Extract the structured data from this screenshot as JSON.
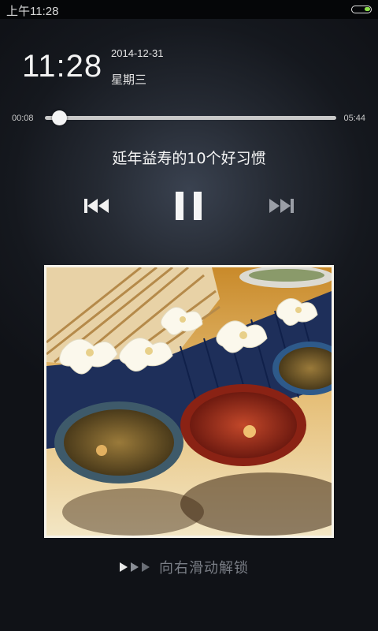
{
  "status_bar": {
    "time": "上午11:28"
  },
  "lockscreen": {
    "clock": "11:28",
    "date": "2014-12-31",
    "weekday": "星期三",
    "unlock_hint": "向右滑动解锁"
  },
  "player": {
    "position": "00:08",
    "duration": "05:44",
    "progress_fraction": 0.023,
    "title": "延年益寿的10个好习惯",
    "prev_icon": "skip-previous-icon",
    "pause_icon": "pause-icon",
    "next_icon": "skip-next-icon"
  },
  "colors": {
    "battery_level": "#8ce04a",
    "next_disabled": "#9a9ea6"
  }
}
